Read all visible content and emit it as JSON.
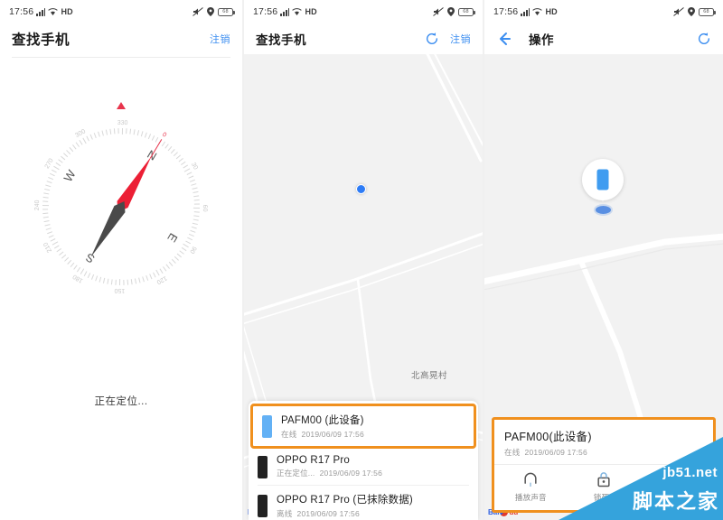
{
  "status_bar": {
    "time": "17:56",
    "signal_icon": "signal-bars-icon",
    "wifi_icon": "wifi-icon",
    "network_label": "HD",
    "mute_icon": "mute-icon",
    "location_icon": "location-pin-icon",
    "battery_level": "68"
  },
  "colors": {
    "accent_blue": "#3c8ef0",
    "highlight_orange": "#f0901e",
    "map_bg": "#f2f2f2",
    "needle_red": "#e8344c",
    "needle_dark": "#4a4a4a",
    "watermark_blue": "#35a3dc"
  },
  "panel_1": {
    "appbar": {
      "title": "查找手机",
      "action_label": "注销"
    },
    "compass": {
      "labels": {
        "n": "N",
        "e": "E",
        "s": "S",
        "w": "W"
      },
      "degree_ticks": [
        "0",
        "30",
        "60",
        "90",
        "120",
        "150",
        "180",
        "210",
        "240",
        "270",
        "300",
        "330"
      ],
      "heading_rotation_deg": 31,
      "marker_icon": "north-marker-icon"
    },
    "status_text": "正在定位..."
  },
  "panel_2": {
    "appbar": {
      "title": "查找手机",
      "refresh_icon": "refresh-icon",
      "action_label": "注销"
    },
    "map": {
      "place_label": "北高晃村",
      "current_location_icon": "blue-location-dot",
      "attribution": "Baidu"
    },
    "device_list": [
      {
        "name": "PAFM00 (此设备)",
        "status": "在线",
        "timestamp": "2019/06/09 17:56",
        "icon": "phone-icon-blue",
        "highlighted": true
      },
      {
        "name": "OPPO R17 Pro",
        "status": "正在定位...",
        "timestamp": "2019/06/09 17:56",
        "icon": "phone-icon-dark",
        "highlighted": false
      },
      {
        "name": "OPPO R17 Pro (已抹除数据)",
        "status": "离线",
        "timestamp": "2019/06/09 17:56",
        "icon": "phone-icon-dark",
        "highlighted": false
      }
    ]
  },
  "panel_3": {
    "appbar": {
      "back_icon": "back-arrow-icon",
      "title": "操作",
      "refresh_icon": "refresh-icon"
    },
    "map": {
      "pin_icon": "phone-map-pin-icon",
      "attribution": "Baidu"
    },
    "device_card": {
      "name": "PAFM00(此设备)",
      "status": "在线",
      "timestamp": "2019/06/09 17:56",
      "actions": [
        {
          "label": "播放声音",
          "icon": "bell-icon"
        },
        {
          "label": "锁死7",
          "icon": "lock-icon"
        },
        {
          "label": "",
          "icon": "erase-icon"
        }
      ]
    }
  },
  "watermark": {
    "url": "jb51.net",
    "brand": "脚本之家"
  }
}
